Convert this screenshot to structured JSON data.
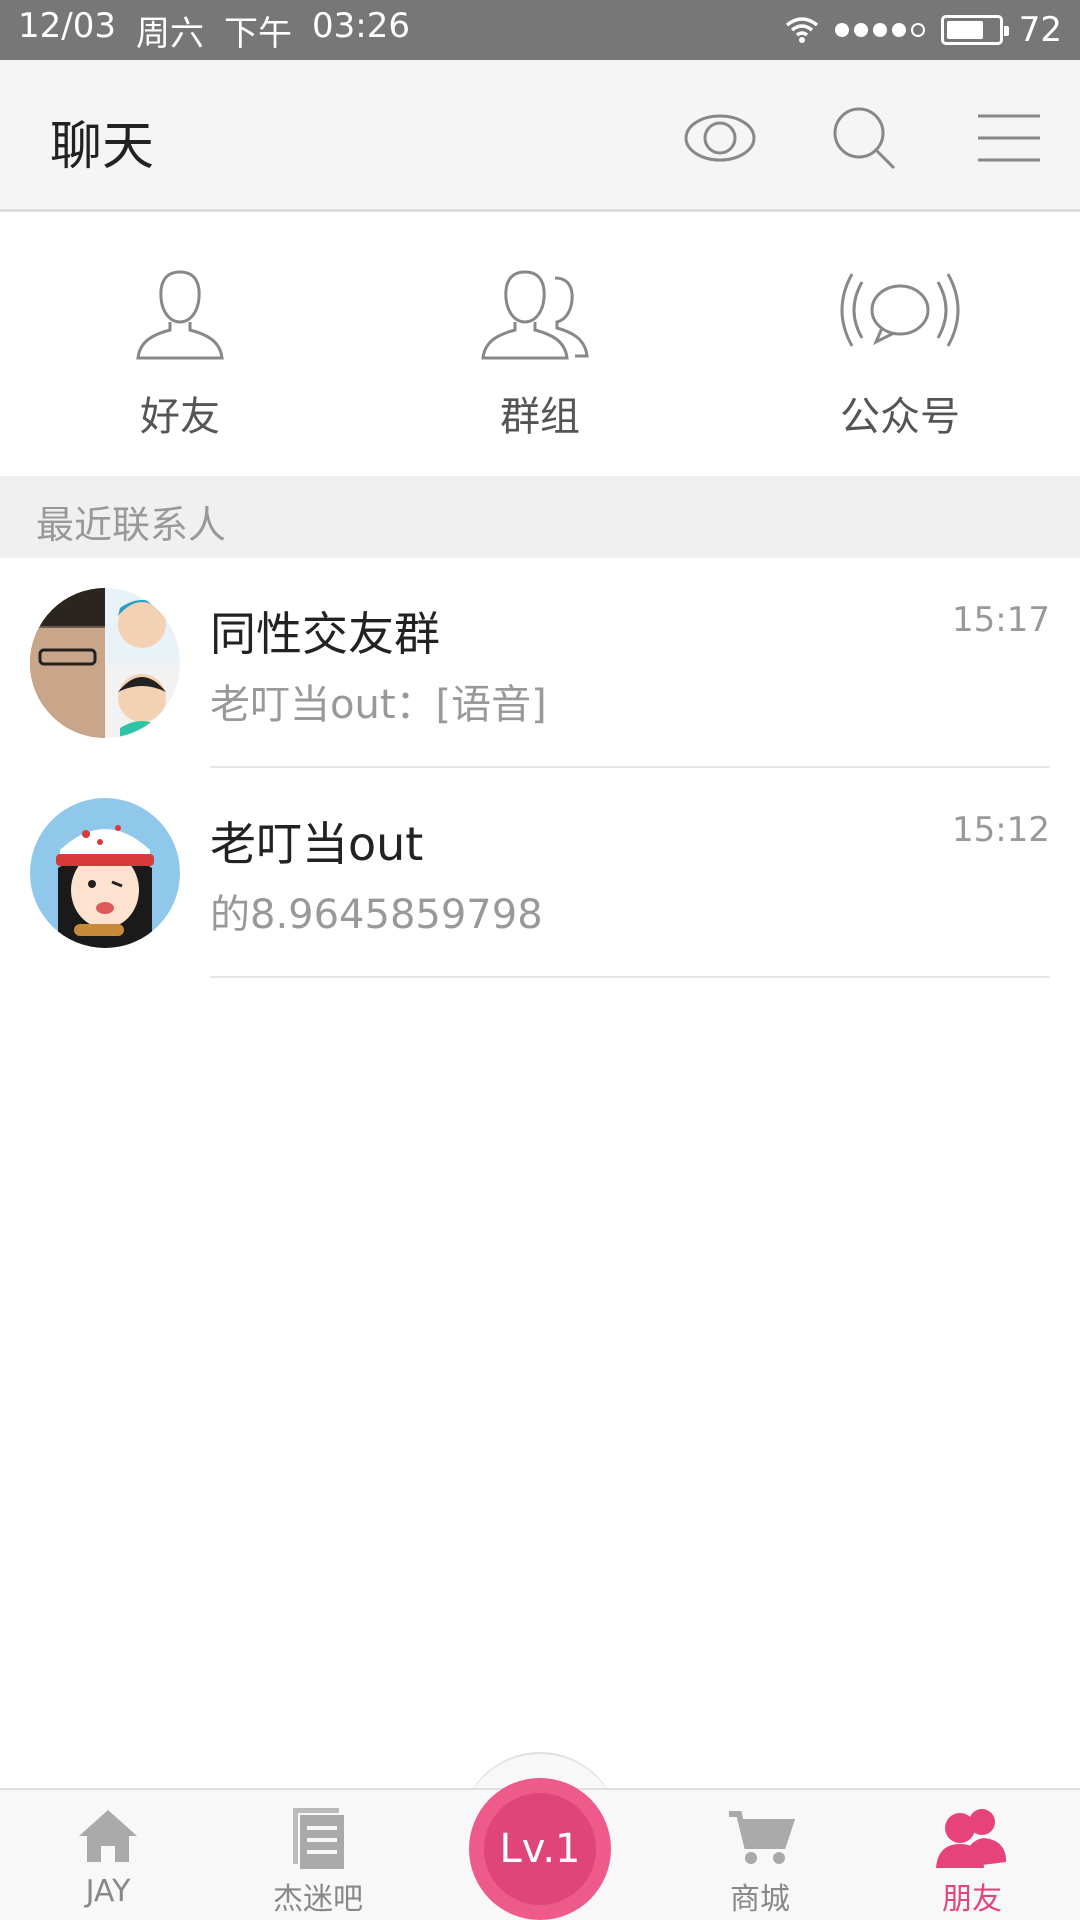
{
  "status_bar": {
    "date": "12/03",
    "weekday": "周六",
    "period": "下午",
    "time": "03:26",
    "battery_level": "72",
    "signal_bars_filled": 4,
    "signal_bars_total": 5,
    "battery_fraction": 0.72
  },
  "header": {
    "title": "聊天",
    "icons": [
      "eye-icon",
      "search-icon",
      "menu-icon"
    ]
  },
  "categories": [
    {
      "label": "好友",
      "icon": "person-icon"
    },
    {
      "label": "群组",
      "icon": "group-icon"
    },
    {
      "label": "公众号",
      "icon": "broadcast-icon"
    }
  ],
  "section": {
    "title": "最近联系人"
  },
  "conversations": [
    {
      "name": "同性交友群",
      "preview": "老叮当out：[语音]",
      "time": "15:17",
      "avatar": "group-avatar"
    },
    {
      "name": "老叮当out",
      "preview": "的8.9645859798",
      "time": "15:12",
      "avatar": "cartoon-avatar"
    }
  ],
  "tabbar": {
    "tabs": [
      {
        "label": "JAY",
        "icon": "home-icon",
        "active": false
      },
      {
        "label": "杰迷吧",
        "icon": "document-icon",
        "active": false
      },
      {
        "label": "商城",
        "icon": "cart-icon",
        "active": false
      },
      {
        "label": "朋友",
        "icon": "friends-icon",
        "active": true
      }
    ],
    "center_button": "Lv.1"
  },
  "colors": {
    "accent": "#e5437a",
    "status_bar": "#777777",
    "header_bg": "#f5f5f5",
    "muted_text": "#999999"
  }
}
